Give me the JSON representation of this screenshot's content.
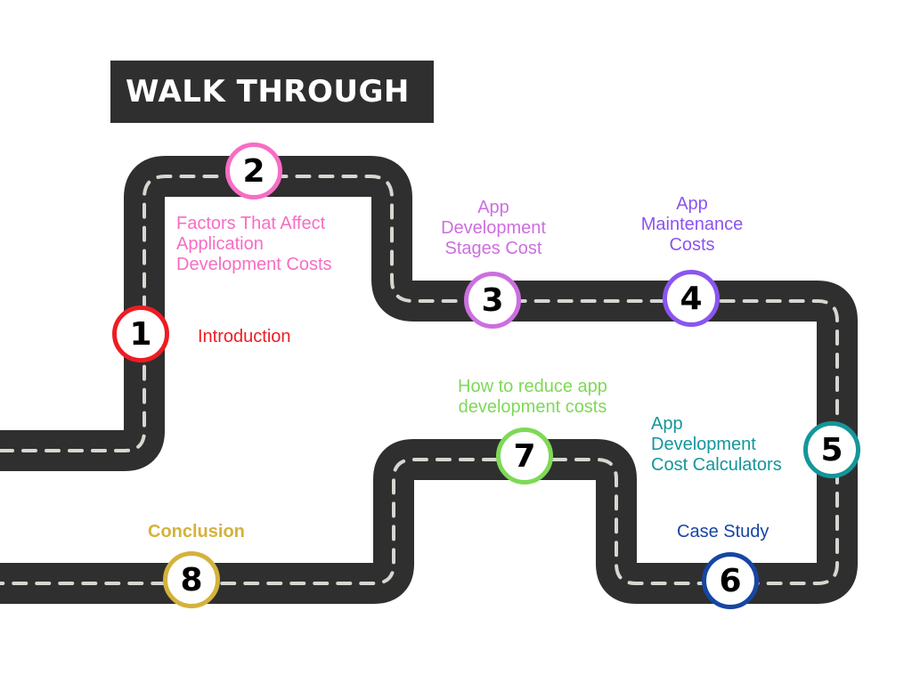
{
  "title": "WALK THROUGH",
  "colors": {
    "road": "#2f2f2f",
    "lane_marking": "#d4d8d0",
    "background": "#ffffff"
  },
  "steps": [
    {
      "number": "1",
      "label": "Introduction",
      "color": "#ee1c24"
    },
    {
      "number": "2",
      "label": "Factors That Affect\nApplication\nDevelopment Costs",
      "color": "#f76dc4"
    },
    {
      "number": "3",
      "label": "App\nDevelopment\nStages Cost",
      "color": "#cd6ee0"
    },
    {
      "number": "4",
      "label": "App\nMaintenance\nCosts",
      "color": "#8b54f0"
    },
    {
      "number": "5",
      "label": "App\nDevelopment\nCost Calculators",
      "color": "#14969a"
    },
    {
      "number": "6",
      "label": "Case Study",
      "color": "#1646a4"
    },
    {
      "number": "7",
      "label": "How to reduce app\ndevelopment costs",
      "color": "#7ed957"
    },
    {
      "number": "8",
      "label": "Conclusion",
      "color": "#d4b23c"
    }
  ]
}
